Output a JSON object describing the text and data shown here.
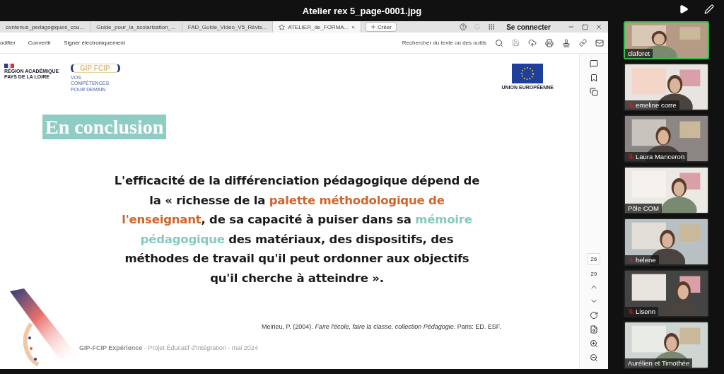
{
  "window": {
    "title": "Atelier rex 5_page-0001.jpg"
  },
  "browser": {
    "tabs": [
      {
        "label": "contenus_pedagogiques_cou...",
        "selected": false
      },
      {
        "label": "Guide_pour_la_scolarisation_...",
        "selected": false
      },
      {
        "label": "FAD_Guide_Video_V5_Révis...",
        "selected": false
      },
      {
        "label": "ATELIER_de_FORMA...",
        "selected": true
      }
    ],
    "close_tab": "×",
    "new_button": "Créer",
    "sign_in": "Se connecter"
  },
  "toolbar": {
    "menu": [
      "odifier",
      "Convertir",
      "Signer électroniquement"
    ],
    "search_placeholder": "Rechercher du texte ou des outils"
  },
  "slide": {
    "region_logo": "RÉGION ACADÉMIQUE PAYS DE LA LOIRE",
    "gip_logo": "GIP FCIP",
    "gip_tagline": "VOS COMPÉTENCES POUR DEMAIN",
    "eu_label": "UNION EUROPÉENNE",
    "heading": "En conclusion",
    "quote": [
      [
        {
          "text": "L'efficacité de la différenciation pédagogique dépend de",
          "color": "#1a1a1a"
        }
      ],
      [
        {
          "text": "la « richesse de la ",
          "color": "#1a1a1a"
        },
        {
          "text": "palette méthodologique de",
          "color": "#d2642a"
        }
      ],
      [
        {
          "text": "l'enseignant",
          "color": "#d2642a"
        },
        {
          "text": ", de sa capacité à puiser dans sa ",
          "color": "#1a1a1a"
        },
        {
          "text": "mémoire",
          "color": "#86c9c0"
        }
      ],
      [
        {
          "text": "pédagogique",
          "color": "#86c9c0"
        },
        {
          "text": " des matériaux, des dispositifs, des",
          "color": "#1a1a1a"
        }
      ],
      [
        {
          "text": "méthodes de travail qu'il peut ordonner aux objectifs",
          "color": "#1a1a1a"
        }
      ],
      [
        {
          "text": "qu'il cherche à atteindre ».",
          "color": "#1a1a1a"
        }
      ]
    ],
    "citation": "Meirieu, P. (2004). *Faire l'école, faire la classe, collection Pédagogie*. Paris: ED. ESF.",
    "footer": "**GIP-FCIP Expérience** - Projet Éducatif d'Intégration - mai 2024"
  },
  "pager": {
    "current": "26",
    "total": "29"
  },
  "participants": [
    {
      "name": "claforet",
      "muted": false,
      "speaking": true
    },
    {
      "name": "emeline corre",
      "muted": true,
      "speaking": false
    },
    {
      "name": "Laura Manceron",
      "muted": true,
      "speaking": false
    },
    {
      "name": "Pôle COM",
      "muted": false,
      "speaking": false
    },
    {
      "name": "helene",
      "muted": true,
      "speaking": false
    },
    {
      "name": "Lisenn",
      "muted": true,
      "speaking": false
    },
    {
      "name": "Aurélien et Timothée",
      "muted": false,
      "speaking": false
    }
  ]
}
